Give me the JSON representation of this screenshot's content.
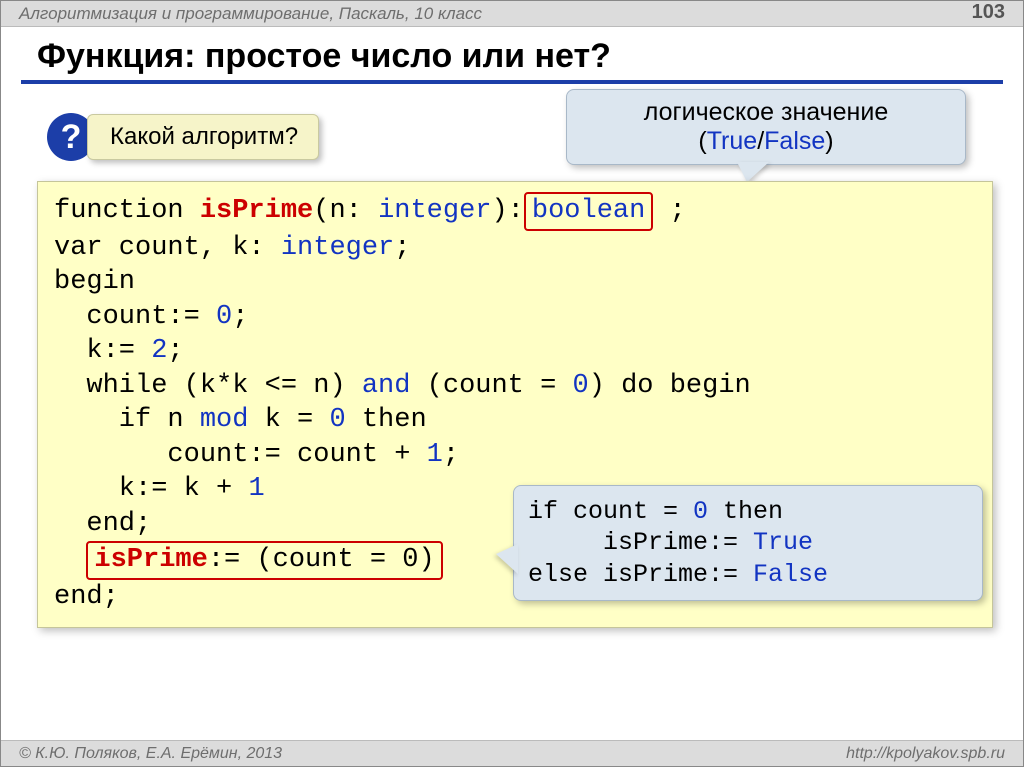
{
  "header": {
    "course": "Алгоритмизация и программирование, Паскаль, 10 класс",
    "page": "103"
  },
  "title": "Функция: простое число или нет?",
  "question": {
    "mark": "?",
    "text": "Какой алгоритм?"
  },
  "bubble_top": {
    "line1": "логическое значение",
    "paren_open": "(",
    "true": "True",
    "slash": "/",
    "false": "False",
    "paren_close": ")"
  },
  "code": {
    "l1a": "function ",
    "l1b": "isPrime",
    "l1c": "(n: ",
    "l1d": "integer",
    "l1e": "):",
    "l1_box": "boolean",
    "l1f": " ;",
    "l2a": "var count, k: ",
    "l2b": "integer",
    "l2c": ";",
    "l3": "begin",
    "l4a": "  count:= ",
    "l4b": "0",
    "l4c": ";",
    "l5a": "  k:= ",
    "l5b": "2",
    "l5c": ";",
    "l6a": "  while (k*k <= n) ",
    "l6b": "and",
    "l6c": " (count = ",
    "l6d": "0",
    "l6e": ") do begin",
    "l7a": "    if n ",
    "l7b": "mod",
    "l7c": " k = ",
    "l7d": "0",
    "l7e": " then",
    "l8a": "       count:= count + ",
    "l8b": "1",
    "l8c": ";",
    "l9a": "    k:= k + ",
    "l9b": "1",
    "l10": "  end;",
    "l11_lead": "  ",
    "l11_box_a": "isPrime",
    "l11_box_b": ":= (count = 0)",
    "l12": "end;"
  },
  "bubble_alt": {
    "r1a": "if count = ",
    "r1b": "0",
    "r1c": " then",
    "r2a": "     isPrime:= ",
    "r2b": "True",
    "r3a": "else isPrime:= ",
    "r3b": "False"
  },
  "footer": {
    "left": "© К.Ю. Поляков, Е.А. Ерёмин, 2013",
    "right": "http://kpolyakov.spb.ru"
  }
}
